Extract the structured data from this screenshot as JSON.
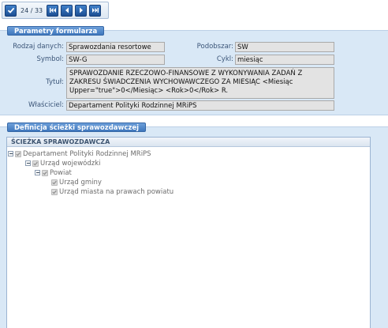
{
  "toolbar": {
    "counter": "24 / 33",
    "buttons": [
      "check-icon",
      "first-icon",
      "prev-icon",
      "next-icon",
      "last-icon"
    ]
  },
  "form": {
    "title": "Parametry formularza",
    "rodzaj_label": "Rodzaj danych:",
    "rodzaj_value": "Sprawozdania resortowe",
    "podobszar_label": "Podobszar:",
    "podobszar_value": "SW",
    "symbol_label": "Symbol:",
    "symbol_value": "SW-G",
    "cykl_label": "Cykl:",
    "cykl_value": "miesiąc",
    "tytul_label": "Tytuł:",
    "tytul_value": "SPRAWOZDANIE RZECZOWO-FINANSOWE Z WYKONYWANIA ZADAŃ Z ZAKRESU ŚWIADCZENIA WYCHOWAWCZEGO ZA MIESIĄC <Miesiąc Upper=\"true\">0</Miesiąc> <Rok>0</Rok> R.",
    "wlasciciel_label": "Właściciel:",
    "wlasciciel_value": "Departament Polityki Rodzinnej MRiPS"
  },
  "path": {
    "title": "Definicja ścieżki sprawozdawczej",
    "column_header": "ŚCIEŻKA SPRAWOZDAWCZA",
    "nodes": [
      {
        "label": "Departament Polityki Rodzinnej MRiPS",
        "expanded": true,
        "checked": true
      },
      {
        "label": "Urząd wojewódzki",
        "expanded": true,
        "checked": true
      },
      {
        "label": "Powiat",
        "expanded": true,
        "checked": true
      },
      {
        "label": "Urząd gminy",
        "checked": true
      },
      {
        "label": "Urząd miasta na prawach powiatu",
        "checked": true
      }
    ]
  },
  "colors": {
    "panel_bg": "#d9e8f6",
    "title_bg": "#4f86c8",
    "button_bg": "#2a62ab",
    "field_bg": "#e3e3e3"
  }
}
